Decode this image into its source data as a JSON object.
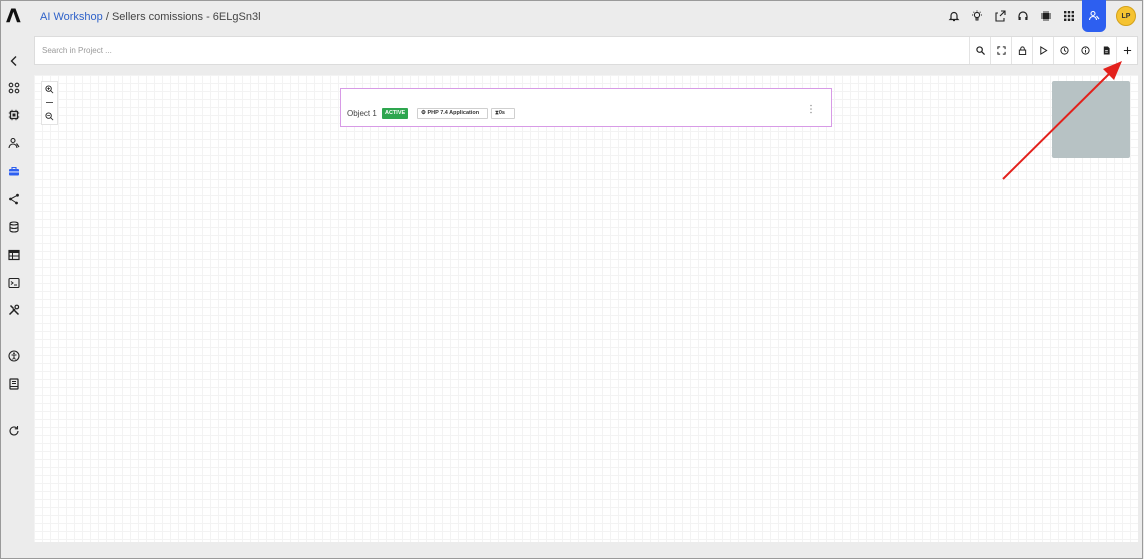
{
  "app": {
    "logo_glyph": "Λ",
    "breadcrumb": {
      "workspace": "AI Workshop",
      "separator": " / ",
      "project": "Sellers comissions - 6ELgSn3l"
    }
  },
  "top_icons": [
    "bell-icon",
    "bulb-icon",
    "share-icon",
    "headset-icon",
    "chip-icon",
    "grid-icon",
    "user-nodes-icon"
  ],
  "user": {
    "initials": "LP",
    "avatar_color": "#f5c331"
  },
  "sidebar": {
    "items": [
      "back-icon",
      "apps-icon",
      "chip-icon",
      "persona-icon",
      "toolbox-icon",
      "network-icon",
      "database-icon",
      "table-icon",
      "terminal-icon",
      "tools-icon",
      "accessibility-icon",
      "book-icon",
      "refresh-icon"
    ],
    "active_item": "toolbox-icon",
    "accent": "#2d5ff0"
  },
  "search": {
    "placeholder": "Search in Project ...",
    "value": ""
  },
  "toolbar": [
    "search-icon",
    "fullscreen-icon",
    "lock-icon",
    "play-icon",
    "clock-icon",
    "info-icon",
    "document-icon",
    "add-icon"
  ],
  "canvas": {
    "zoom_controls": [
      "zoom-in-icon",
      "zoom-out-icon"
    ],
    "node": {
      "title": "Object 1",
      "status": "ACTIVE",
      "status_color": "#2ea64f",
      "runtime": "PHP 7.4 Application",
      "duration": "0s",
      "border_color": "#d79ae6"
    },
    "minimap_color": "#b7c2c4"
  },
  "annotation": {
    "arrow_color": "#e3211c",
    "target": "add-button"
  }
}
